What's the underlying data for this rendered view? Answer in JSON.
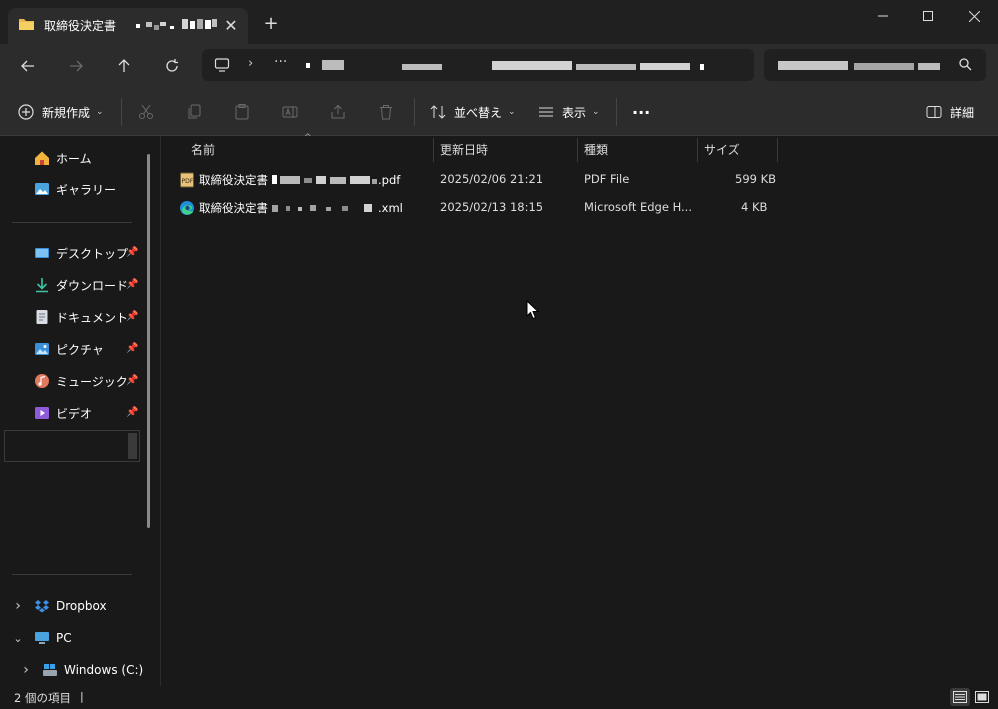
{
  "window": {
    "tab_title": "取締役決定書",
    "new_tab_symbol": "+",
    "close_tab_symbol": "✕"
  },
  "address": {
    "more_symbol": "···"
  },
  "toolbar": {
    "new_label": "新規作成",
    "sort_label": "並べ替え",
    "view_label": "表示",
    "more_symbol": "···",
    "details_label": "詳細"
  },
  "sidebar": {
    "home": "ホーム",
    "gallery": "ギャラリー",
    "quick_access": [
      {
        "label": "デスクトップ",
        "icon": "desktop-icon"
      },
      {
        "label": "ダウンロード",
        "icon": "download-icon"
      },
      {
        "label": "ドキュメント",
        "icon": "documents-icon"
      },
      {
        "label": "ピクチャ",
        "icon": "pictures-icon"
      },
      {
        "label": "ミュージック",
        "icon": "music-icon"
      },
      {
        "label": "ビデオ",
        "icon": "videos-icon"
      }
    ],
    "dropbox": "Dropbox",
    "pc": "PC",
    "drive": "Windows (C:)"
  },
  "columns": {
    "name": "名前",
    "date": "更新日時",
    "type": "種類",
    "size": "サイズ"
  },
  "files": [
    {
      "name_prefix": "取締役決定書",
      "name_suffix": ".pdf",
      "date": "2025/02/06 21:21",
      "type": "PDF File",
      "size": "599 KB",
      "icon": "pdf-file-icon"
    },
    {
      "name_prefix": "取締役決定書",
      "name_suffix": ".xml",
      "date": "2025/02/13 18:15",
      "type": "Microsoft Edge H...",
      "size": "4 KB",
      "icon": "edge-icon"
    }
  ],
  "status": {
    "item_count": "2 個の項目",
    "cursor_bar": "|"
  },
  "colors": {
    "titlebar": "#202020",
    "toolbar": "#2c2c2c",
    "content": "#191919",
    "folder": "#f2c94c",
    "accent": "#4aa3df"
  }
}
